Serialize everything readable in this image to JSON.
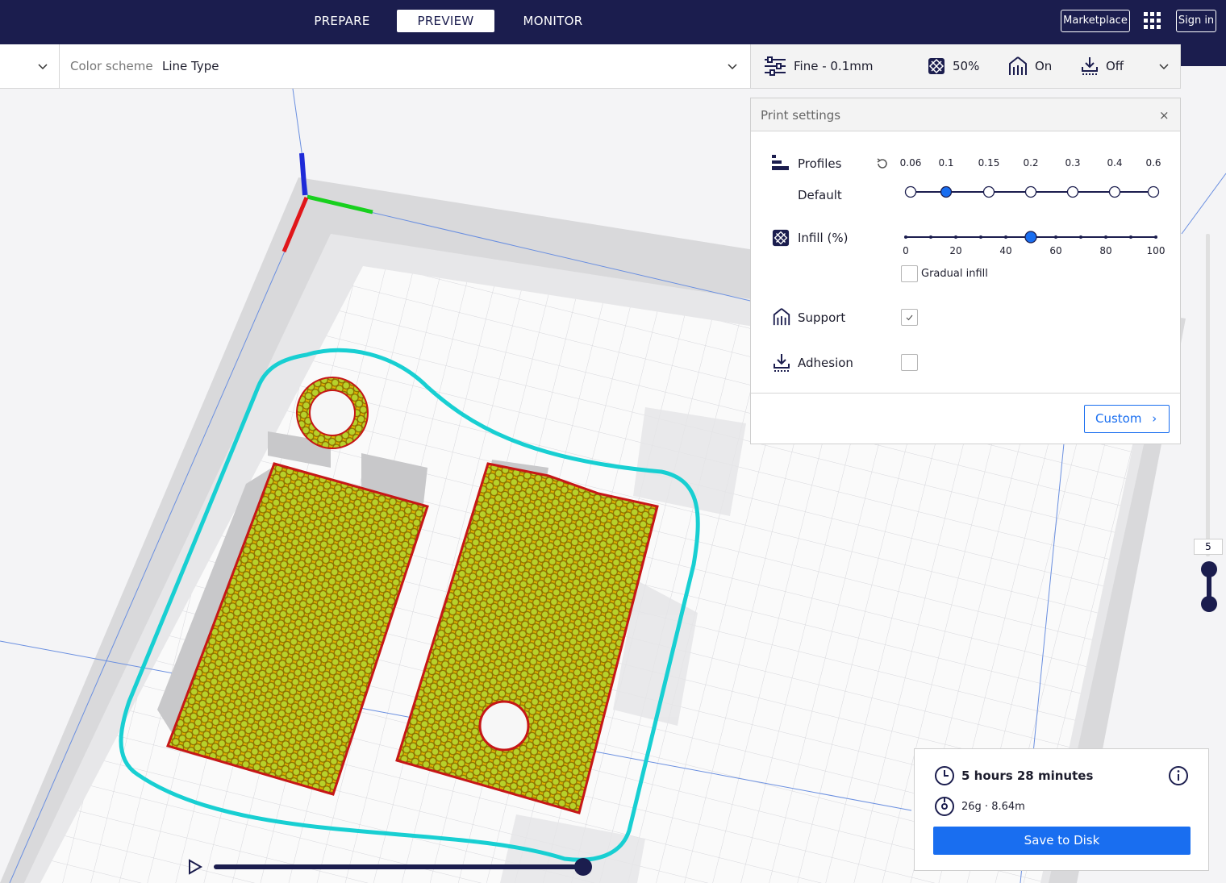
{
  "stages": [
    {
      "label": "PREPARE"
    },
    {
      "label": "PREVIEW"
    },
    {
      "label": "MONITOR"
    }
  ],
  "header": {
    "marketplace_label": "Marketplace",
    "signin_label": "Sign in",
    "apps_icon": "apps-grid-icon"
  },
  "view": {
    "color_scheme_label": "Color scheme",
    "color_scheme_value": "Line Type"
  },
  "print_header": {
    "profile": "Fine - 0.1mm",
    "infill": "50%",
    "support": "On",
    "adhesion": "Off"
  },
  "print_settings": {
    "title": "Print settings",
    "close_icon": "×",
    "profiles_label": "Profiles",
    "profile_default": "Default",
    "profile_ticks": [
      "0.06",
      "0.1",
      "0.15",
      "0.2",
      "0.3",
      "0.4",
      "0.6"
    ],
    "profile_selected_index": 1,
    "infill_label": "Infill (%)",
    "infill_ticks": [
      "0",
      "20",
      "40",
      "60",
      "80",
      "100"
    ],
    "infill_value_percent": 50,
    "gradual_infill_label": "Gradual infill",
    "support_label": "Support",
    "support_checked": true,
    "adhesion_label": "Adhesion",
    "adhesion_checked": false,
    "custom_label": "Custom"
  },
  "layer_slider": {
    "value": "5"
  },
  "estimate": {
    "time": "5 hours 28 minutes",
    "material": "26g · 8.64m",
    "save_label": "Save to Disk"
  },
  "colors": {
    "topbar": "#1b1d4e",
    "accent": "#196ef0",
    "travel": "#00d0d0",
    "infill": "#e5b800",
    "wall": "#d12020"
  }
}
